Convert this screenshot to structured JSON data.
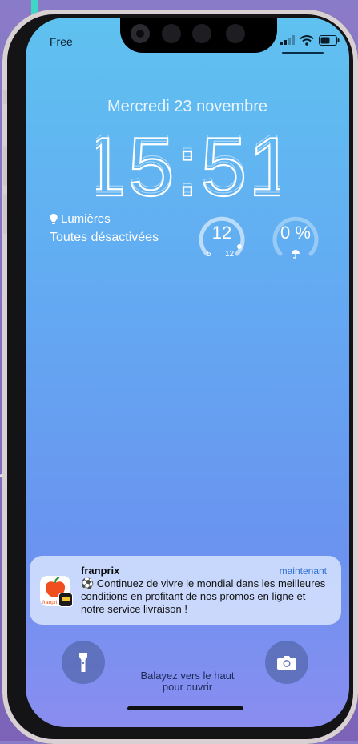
{
  "status_bar": {
    "carrier": "Free",
    "icons": [
      "signal-icon",
      "wifi-icon",
      "battery-icon"
    ]
  },
  "lock_screen": {
    "date": "Mercredi 23 novembre",
    "time": "15:51"
  },
  "widgets": {
    "lights": {
      "icon": "lightbulb-icon",
      "title": "Lumières",
      "status": "Toutes désactivées"
    },
    "temperature": {
      "value": "12",
      "low": "5",
      "high": "12",
      "level": 1.0
    },
    "precipitation": {
      "value": "0 %",
      "icon": "umbrella-icon",
      "level": 0.0
    }
  },
  "notification": {
    "app_name": "franprix",
    "time": "maintenant",
    "message": "⚽ Continuez de vivre le mondial dans les meilleures conditions en profitant de nos promos en ligne et notre service livraison !",
    "icon": "franprix-app-icon",
    "icon_label": "franprix"
  },
  "controls": {
    "flashlight_icon": "flashlight-icon",
    "camera_icon": "camera-icon"
  },
  "hint": {
    "line1": "Balayez vers le haut",
    "line2": "pour ouvrir"
  },
  "colors": {
    "accent_link": "#2f6fd0",
    "franprix_orange": "#f04e1f"
  }
}
